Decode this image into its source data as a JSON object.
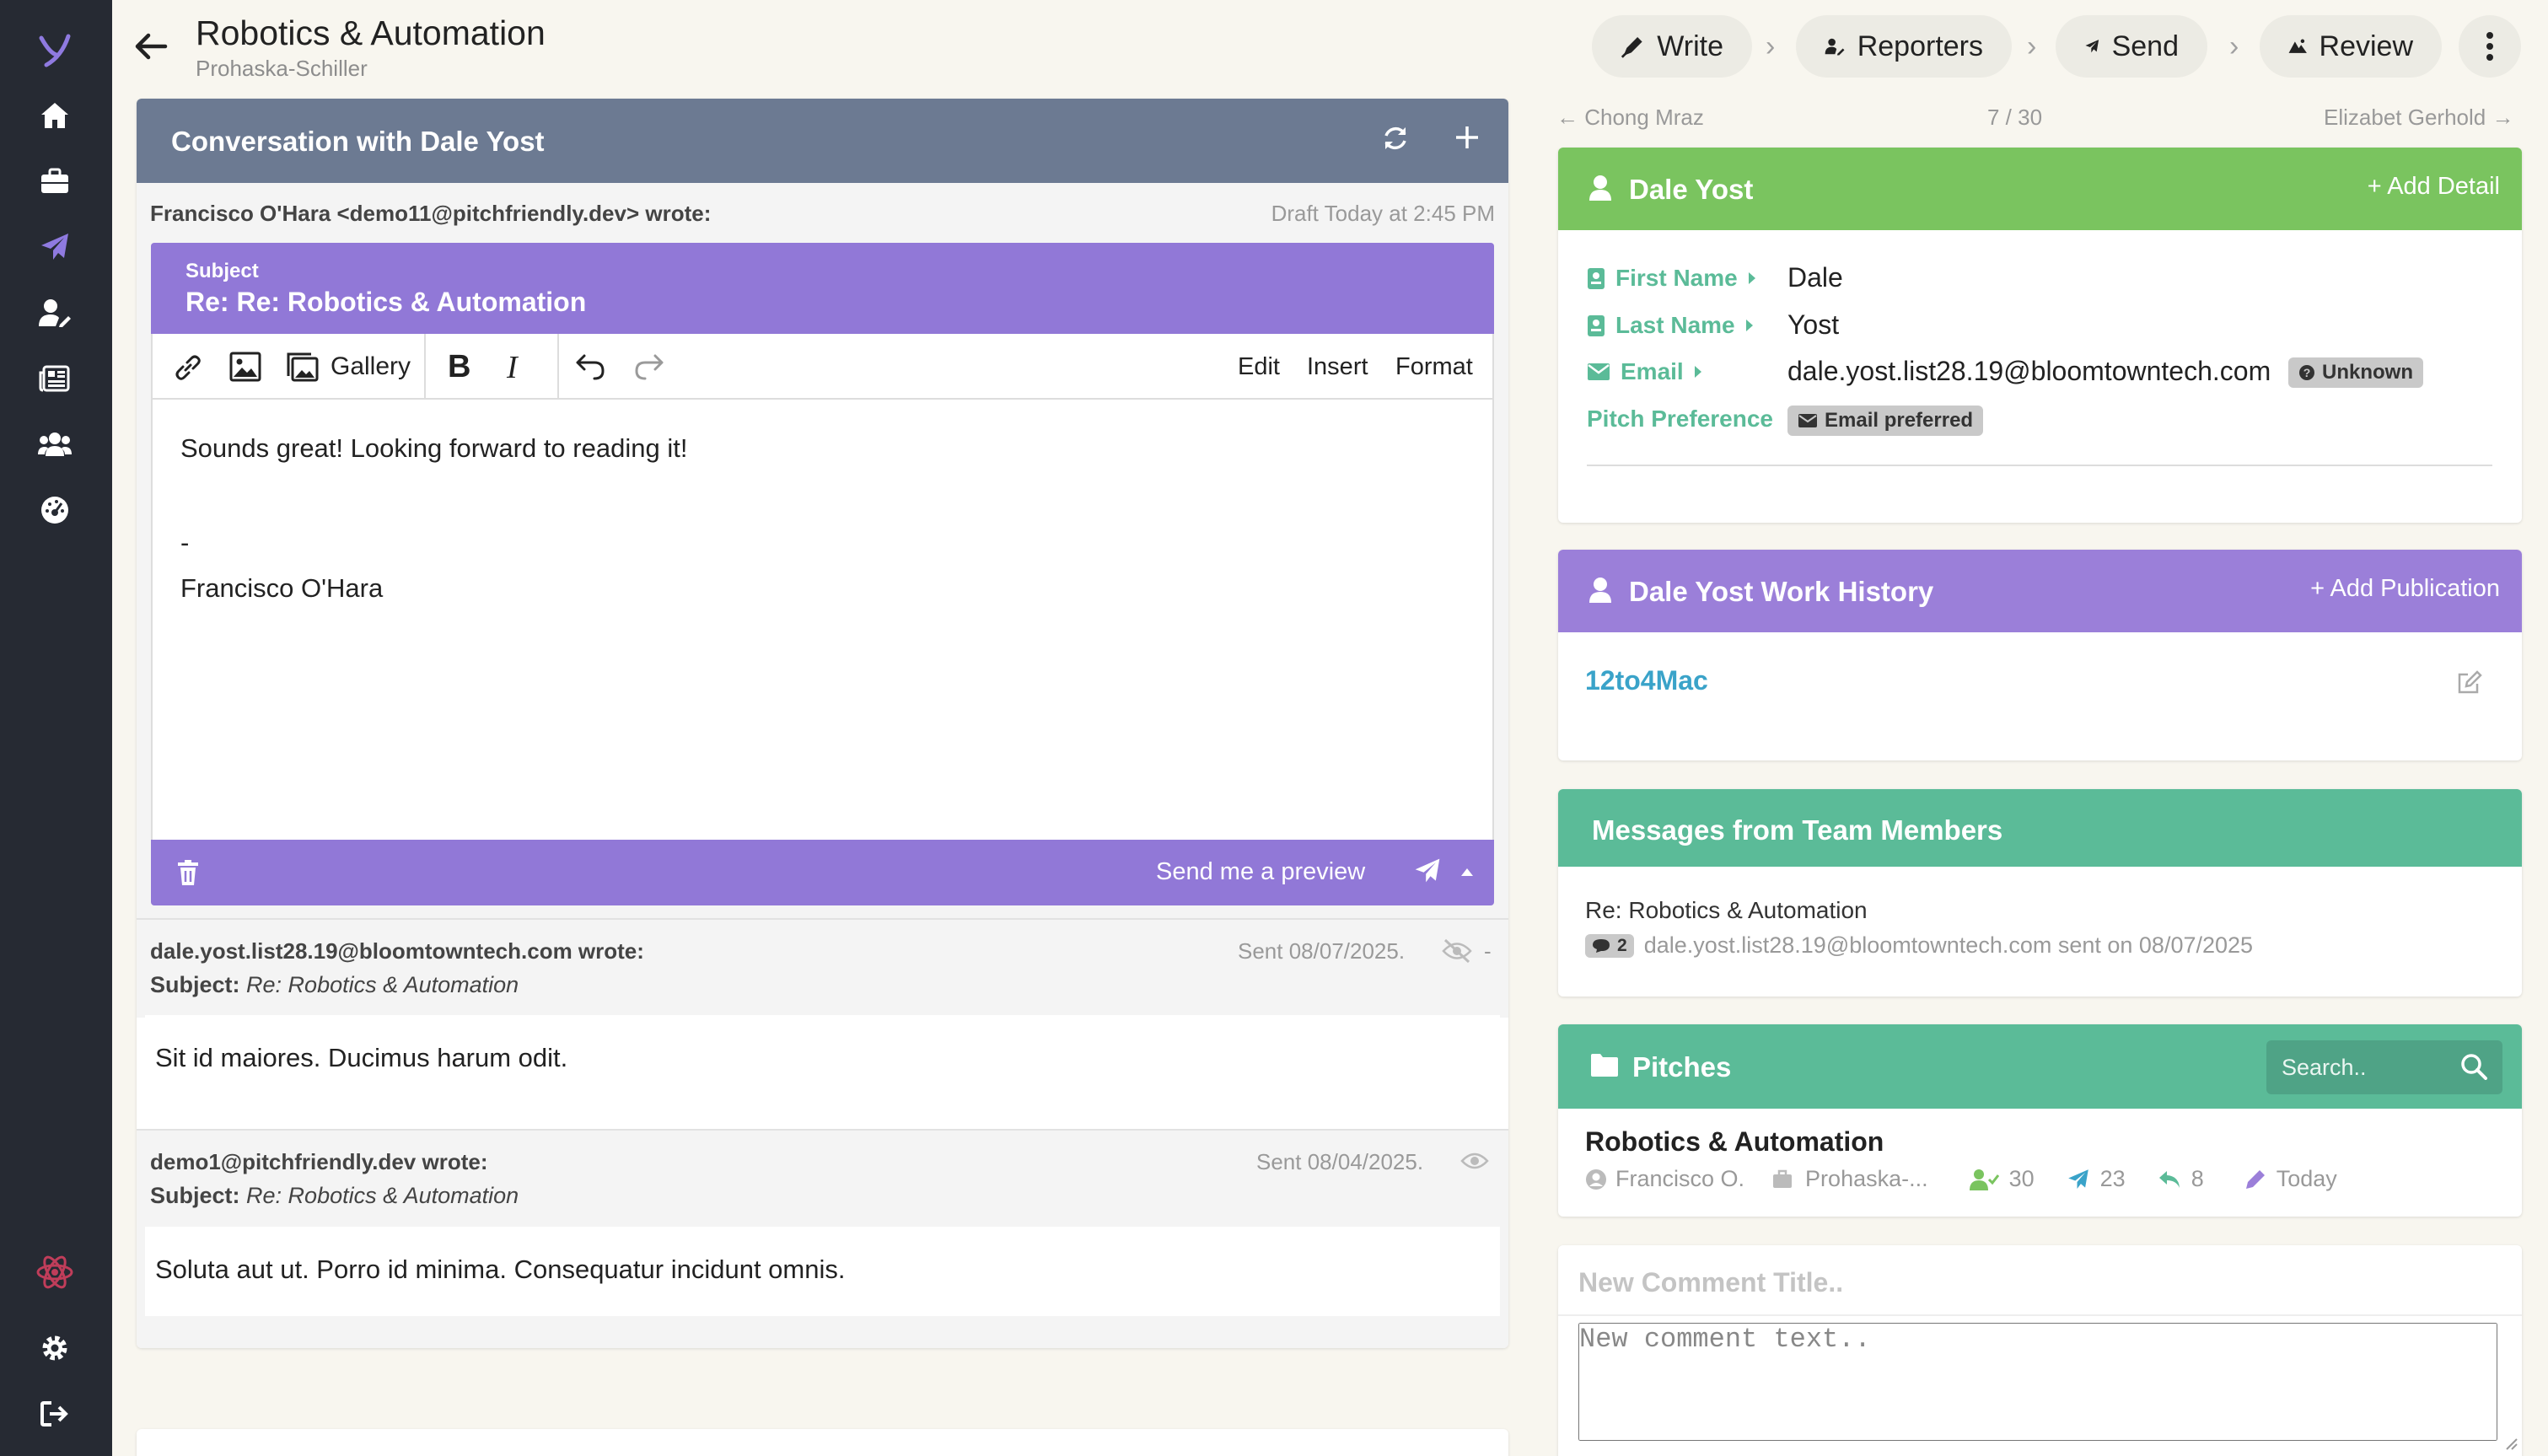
{
  "header": {
    "title": "Robotics & Automation",
    "subtitle": "Prohaska-Schiller",
    "steps": [
      {
        "label": "Write",
        "icon": "pen-icon"
      },
      {
        "label": "Reporters",
        "icon": "user-edit-icon"
      },
      {
        "label": "Send",
        "icon": "paper-plane-icon"
      },
      {
        "label": "Review",
        "icon": "mountain-icon"
      }
    ]
  },
  "conversation": {
    "title": "Conversation with Dale Yost",
    "draft": {
      "author": "Francisco O'Hara <demo11@pitchfriendly.dev> wrote:",
      "status": "Draft Today at 2:45 PM",
      "subject_label": "Subject",
      "subject_value": "Re: Re: Robotics & Automation",
      "toolbar": {
        "gallery": "Gallery",
        "edit": "Edit",
        "insert": "Insert",
        "format": "Format"
      },
      "body_line1": "Sounds great! Looking forward to reading it!",
      "body_dash": "-",
      "body_signature": "Francisco O'Hara",
      "preview_label": "Send me a preview"
    },
    "messages": [
      {
        "from": "dale.yost.list28.19@bloomtowntech.com wrote:",
        "subject_label": "Subject:",
        "subject": "Re: Robotics & Automation",
        "sent": "Sent 08/07/2025.",
        "extra": "-",
        "body": "Sit id maiores. Ducimus harum odit."
      },
      {
        "from": "demo1@pitchfriendly.dev wrote:",
        "subject_label": "Subject:",
        "subject": "Re: Robotics & Automation",
        "sent": "Sent 08/04/2025.",
        "body": "Soluta aut ut. Porro id minima. Consequatur incidunt omnis."
      }
    ]
  },
  "nav": {
    "prev": "← Chong Mraz",
    "counter": "7 / 30",
    "next": "Elizabet Gerhold →"
  },
  "contact": {
    "name": "Dale Yost",
    "add_detail": "+ Add Detail",
    "first_name_label": "First Name",
    "first_name": "Dale",
    "last_name_label": "Last Name",
    "last_name": "Yost",
    "email_label": "Email",
    "email": "dale.yost.list28.19@bloomtowntech.com",
    "email_status": "Unknown",
    "pitch_pref_label": "Pitch Preference",
    "pitch_pref": "Email preferred"
  },
  "work_history": {
    "title": "Dale Yost Work History",
    "add_label": "+ Add Publication",
    "publication": "12to4Mac"
  },
  "team_messages": {
    "title": "Messages from Team Members",
    "subject": "Re: Robotics & Automation",
    "count": "2",
    "meta": "dale.yost.list28.19@bloomtowntech.com sent on 08/07/2025"
  },
  "pitches": {
    "title": "Pitches",
    "search_placeholder": "Search..",
    "item": {
      "title": "Robotics & Automation",
      "owner": "Francisco O.",
      "company": "Prohaska-...",
      "reporters": "30",
      "sent": "23",
      "replies": "8",
      "updated": "Today"
    }
  },
  "comment": {
    "title_placeholder": "New Comment Title..",
    "text_placeholder": "New comment text.."
  }
}
